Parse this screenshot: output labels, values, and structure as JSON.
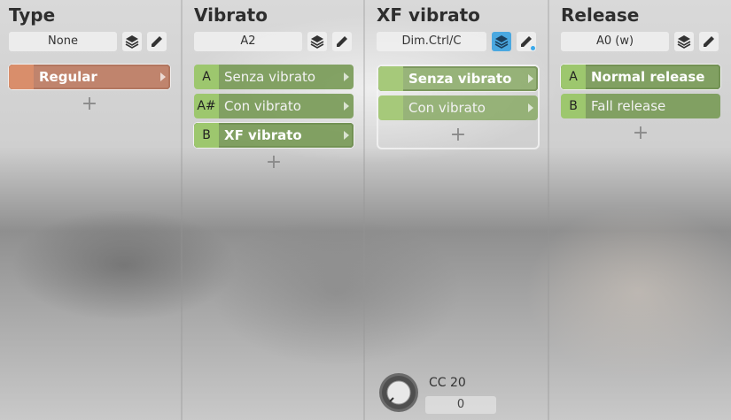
{
  "columns": [
    {
      "title": "Type",
      "field": "None",
      "articulations": [
        {
          "key": "",
          "label": "Regular",
          "selected": true
        }
      ]
    },
    {
      "title": "Vibrato",
      "field": "A2",
      "articulations": [
        {
          "key": "A",
          "label": "Senza vibrato"
        },
        {
          "key": "A#",
          "label": "Con vibrato"
        },
        {
          "key": "B",
          "label": "XF vibrato",
          "selected": true
        }
      ]
    },
    {
      "title": "XF vibrato",
      "field": "Dim.Ctrl/C",
      "articulations": [
        {
          "key": "",
          "label": "Senza vibrato",
          "selected": true
        },
        {
          "key": "",
          "label": "Con vibrato"
        }
      ],
      "controller": {
        "label": "CC 20",
        "value": "0"
      }
    },
    {
      "title": "Release",
      "field": "A0 (w)",
      "articulations": [
        {
          "key": "A",
          "label": "Normal release",
          "selected": true
        },
        {
          "key": "B",
          "label": "Fall release"
        }
      ]
    }
  ],
  "add_symbol": "+",
  "icons": {
    "layers": "layers-icon",
    "edit": "pencil-icon"
  },
  "colors": {
    "accent_blue": "#4aa8e0",
    "green": "#7a9b58",
    "orange": "#be7d64"
  }
}
